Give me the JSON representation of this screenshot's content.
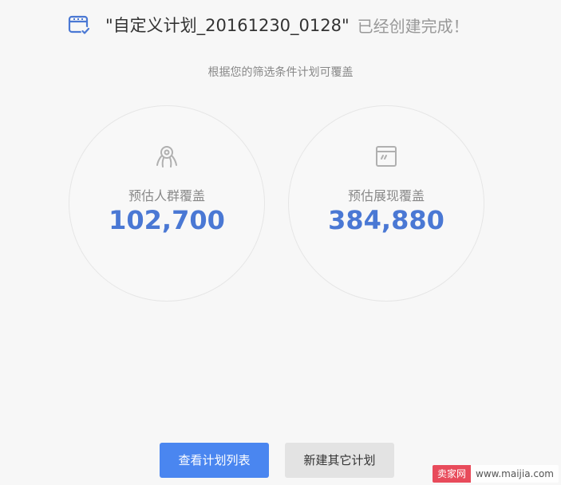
{
  "header": {
    "plan_name": "\"自定义计划_20161230_0128\"",
    "status_text": "已经创建完成！",
    "icon": "calendar-check-icon"
  },
  "subtitle": "根据您的筛选条件计划可覆盖",
  "metrics": [
    {
      "icon": "audience-icon",
      "label": "预估人群覆盖",
      "value": "102,700"
    },
    {
      "icon": "impression-window-icon",
      "label": "预估展现覆盖",
      "value": "384,880"
    }
  ],
  "buttons": {
    "view_plans": "查看计划列表",
    "new_plan": "新建其它计划"
  },
  "watermark": {
    "brand": "卖家网",
    "url": "www.maijia.com"
  },
  "colors": {
    "accent": "#4a78d4",
    "primary_button": "#4a86f0",
    "secondary_button": "#e3e3e3",
    "watermark_brand": "#e84b5b"
  }
}
